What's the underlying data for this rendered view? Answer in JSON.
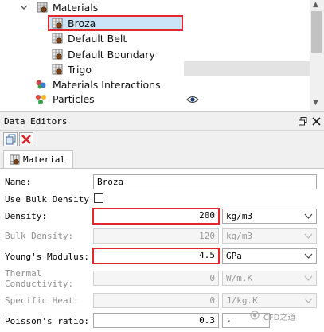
{
  "tree": {
    "items": [
      {
        "label": "Materials",
        "icon": "materials-folder-icon"
      },
      {
        "label": "Broza",
        "icon": "material-grid-icon",
        "selected": true
      },
      {
        "label": "Default Belt",
        "icon": "material-grid-icon"
      },
      {
        "label": "Default Boundary",
        "icon": "material-grid-icon"
      },
      {
        "label": "Trigo",
        "icon": "material-grid-icon"
      },
      {
        "label": "Materials Interactions",
        "icon": "interactions-icon"
      },
      {
        "label": "Particles",
        "icon": "particles-icon",
        "extra_icon": "eye-icon"
      }
    ]
  },
  "data_editors": {
    "title": "Data Editors",
    "float_icon": "float-window-icon",
    "close_icon": "close-icon",
    "toolbar": {
      "copy_icon": "copy-icon",
      "delete_icon": "delete-icon"
    },
    "tab": {
      "label": "Material",
      "icon": "material-grid-icon"
    },
    "fields": {
      "name": {
        "label": "Name:",
        "value": "Broza"
      },
      "use_bulk_density": {
        "label": "Use Bulk Density",
        "checked": false
      },
      "density": {
        "label": "Density:",
        "value": "200",
        "unit": "kg/m3"
      },
      "bulk_density": {
        "label": "Bulk Density:",
        "value": "120",
        "unit": "kg/m3"
      },
      "youngs_modulus": {
        "label": "Young's Modulus:",
        "value": "4.5",
        "unit": "GPa"
      },
      "thermal_conductivity": {
        "label": "Thermal Conductivity:",
        "label_line1": "Thermal",
        "label_line2": "Conductivity:",
        "value": "0",
        "unit": "W/m.K"
      },
      "specific_heat": {
        "label": "Specific Heat:",
        "value": "0",
        "unit": "J/kg.K"
      },
      "poissons_ratio": {
        "label": "Poisson's ratio:",
        "value": "0.3",
        "unit": "-"
      }
    }
  },
  "watermark": "CFD之道",
  "colors": {
    "highlight": "#e0282e",
    "selection": "#cce4f7"
  }
}
